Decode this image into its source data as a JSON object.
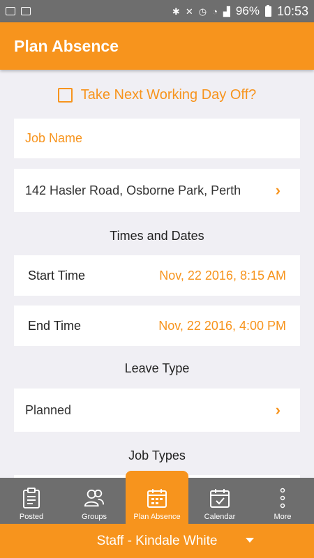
{
  "status_bar": {
    "battery_text": "96%",
    "time": "10:53"
  },
  "header": {
    "title": "Plan Absence"
  },
  "form": {
    "next_day_label": "Take Next Working Day Off?",
    "job_name_placeholder": "Job Name",
    "address": "142 Hasler Road, Osborne Park, Perth",
    "times_section": "Times and Dates",
    "start_label": "Start Time",
    "start_value": "Nov, 22 2016, 8:15 AM",
    "end_label": "End Time",
    "end_value": "Nov, 22 2016, 4:00 PM",
    "leave_section": "Leave Type",
    "leave_value": "Planned",
    "jobtypes_section": "Job Types"
  },
  "tabs": [
    {
      "label": "Posted",
      "icon": "clipboard-icon"
    },
    {
      "label": "Groups",
      "icon": "groups-icon"
    },
    {
      "label": "Plan Absence",
      "icon": "calendar-plan-icon",
      "active": true
    },
    {
      "label": "Calendar",
      "icon": "calendar-check-icon"
    },
    {
      "label": "More",
      "icon": "more-vertical-icon"
    }
  ],
  "footer": {
    "label": "Staff - Kindale White"
  },
  "colors": {
    "accent": "#f7941d",
    "bar_gray": "#6e6e6e",
    "background": "#f0eff4"
  }
}
